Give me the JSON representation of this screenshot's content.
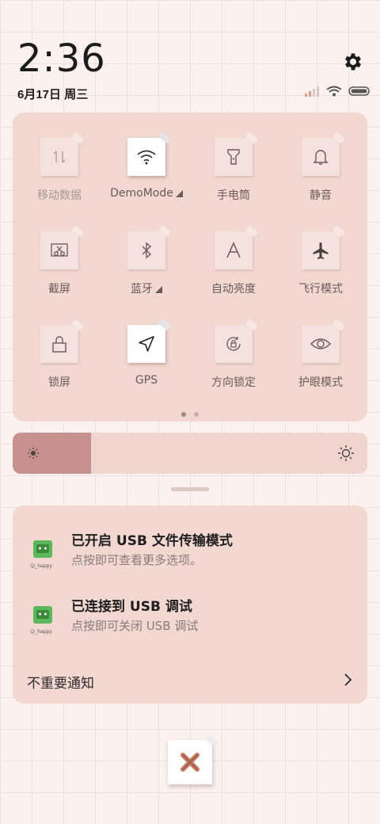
{
  "status": {
    "time": "2:36",
    "date": "6月17日 周三"
  },
  "quick_settings": {
    "tiles": [
      {
        "label": "移动数据",
        "icon": "mobile-data-icon",
        "active": false,
        "dim": true
      },
      {
        "label": "DemoMode",
        "icon": "wifi-icon",
        "active": true,
        "arrow": true
      },
      {
        "label": "手电筒",
        "icon": "flashlight-icon",
        "active": false
      },
      {
        "label": "静音",
        "icon": "bell-icon",
        "active": false
      },
      {
        "label": "截屏",
        "icon": "screenshot-icon",
        "active": false
      },
      {
        "label": "蓝牙",
        "icon": "bluetooth-icon",
        "active": false,
        "arrow": true
      },
      {
        "label": "自动亮度",
        "icon": "auto-brightness-icon",
        "active": false
      },
      {
        "label": "飞行模式",
        "icon": "airplane-icon",
        "active": false
      },
      {
        "label": "锁屏",
        "icon": "lock-icon",
        "active": false
      },
      {
        "label": "GPS",
        "icon": "location-icon",
        "active": true
      },
      {
        "label": "方向锁定",
        "icon": "rotation-lock-icon",
        "active": false
      },
      {
        "label": "护眼模式",
        "icon": "eye-icon",
        "active": false
      }
    ],
    "page_count": 2,
    "current_page": 1
  },
  "brightness": {
    "level": 0.22
  },
  "notifications": [
    {
      "title": "已开启 USB 文件传输模式",
      "text": "点按即可查看更多选项。",
      "icon": "android-happy-icon"
    },
    {
      "title": "已连接到 USB 调试",
      "text": "点按即可关闭 USB 调试",
      "icon": "android-happy-icon"
    }
  ],
  "unimportant_label": "不重要通知",
  "colors": {
    "panel": "#f3d7d1",
    "accent": "#c6918f",
    "clear_x": "#c8785f"
  }
}
